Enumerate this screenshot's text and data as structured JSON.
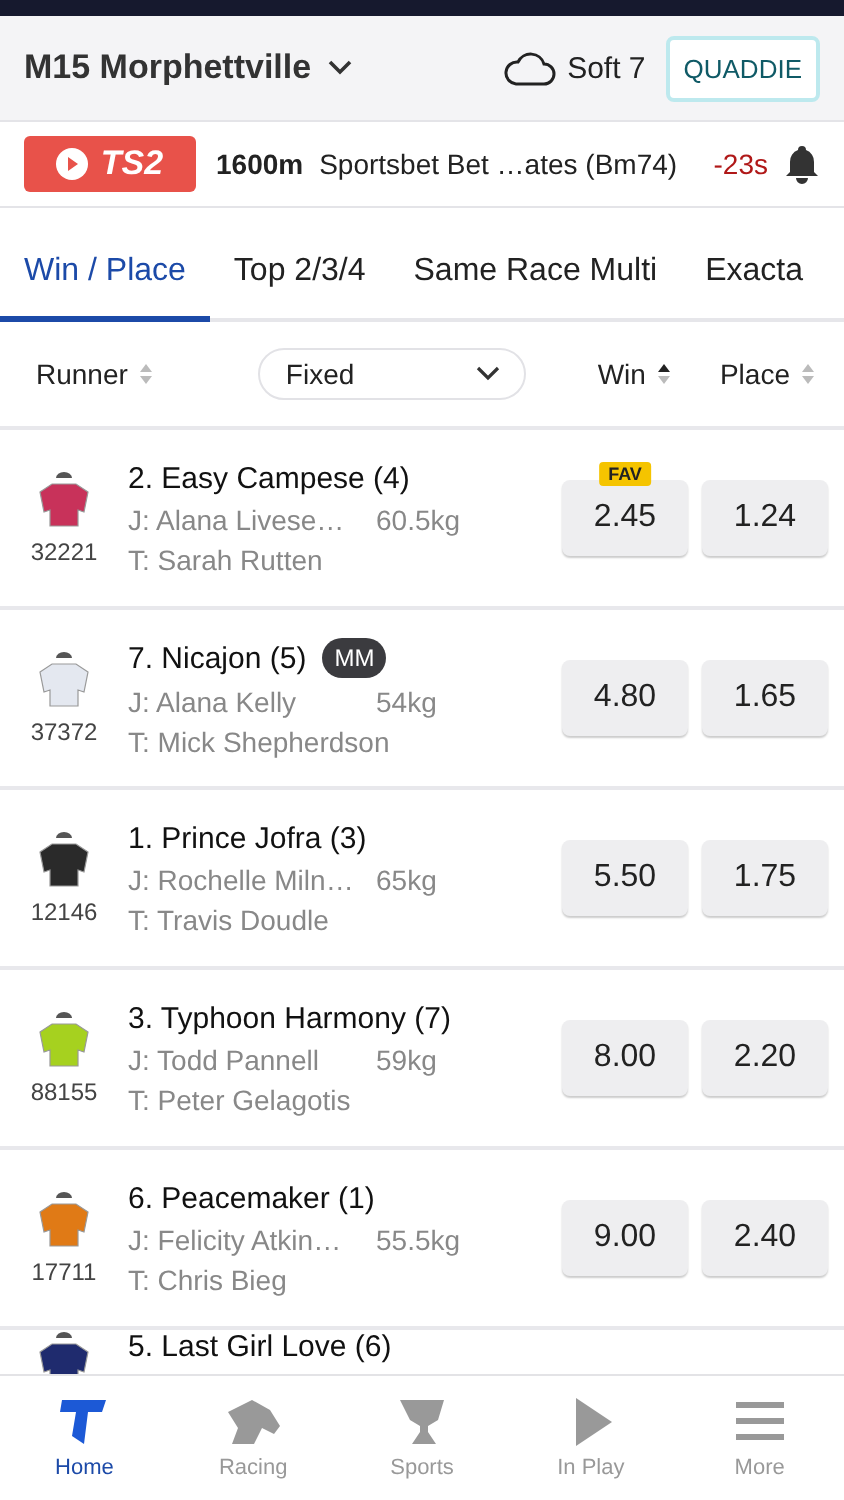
{
  "header": {
    "title": "M15 Morphettville",
    "track_condition": "Soft 7",
    "button": "QUADDIE"
  },
  "race_bar": {
    "channel": "TS2",
    "distance": "1600m",
    "race_name": "Sportsbet Bet …ates (Bm74)",
    "countdown": "-23s"
  },
  "tabs": [
    {
      "label": "Win / Place",
      "selected": true
    },
    {
      "label": "Top 2/3/4",
      "selected": false
    },
    {
      "label": "Same Race Multi",
      "selected": false
    },
    {
      "label": "Exacta",
      "selected": false
    }
  ],
  "columns": {
    "runner": {
      "label": "Runner",
      "sorted": false
    },
    "price_type": "Fixed",
    "win": {
      "label": "Win",
      "sorted": true
    },
    "place": {
      "label": "Place",
      "sorted": false
    }
  },
  "runners": [
    {
      "name": "2. Easy Campese (4)",
      "form": "32221",
      "jockey": "J: Alana Livese…",
      "weight": "60.5kg",
      "trainer": "T: Sarah Rutten",
      "win": "2.45",
      "place": "1.24",
      "win_badge": "FAV",
      "color": "#c8325a"
    },
    {
      "name": "7. Nicajon (5)",
      "badge": "MM",
      "form": "37372",
      "jockey": "J: Alana Kelly",
      "weight": "54kg",
      "trainer": "T: Mick Shepherdson",
      "win": "4.80",
      "place": "1.65",
      "color": "#e4e8f0"
    },
    {
      "name": "1. Prince Jofra (3)",
      "form": "12146",
      "jockey": "J: Rochelle Miln…",
      "weight": "65kg",
      "trainer": "T: Travis Doudle",
      "win": "5.50",
      "place": "1.75",
      "color": "#2a2a2a"
    },
    {
      "name": "3. Typhoon Harmony (7)",
      "form": "88155",
      "jockey": "J: Todd Pannell",
      "weight": "59kg",
      "trainer": "T: Peter Gelagotis",
      "win": "8.00",
      "place": "2.20",
      "color": "#a6d11f"
    },
    {
      "name": "6. Peacemaker (1)",
      "form": "17711",
      "jockey": "J: Felicity Atkin…",
      "weight": "55.5kg",
      "trainer": "T: Chris Bieg",
      "win": "9.00",
      "place": "2.40",
      "color": "#e07a16"
    },
    {
      "name": "5. Last Girl Love (6)",
      "color": "#1f2b6e"
    }
  ],
  "nav": [
    {
      "label": "Home",
      "kind": "home",
      "selected": true
    },
    {
      "label": "Racing",
      "kind": "racing",
      "selected": false
    },
    {
      "label": "Sports",
      "kind": "sports",
      "selected": false
    },
    {
      "label": "In Play",
      "kind": "play",
      "selected": false
    },
    {
      "label": "More",
      "kind": "more",
      "selected": false
    }
  ]
}
